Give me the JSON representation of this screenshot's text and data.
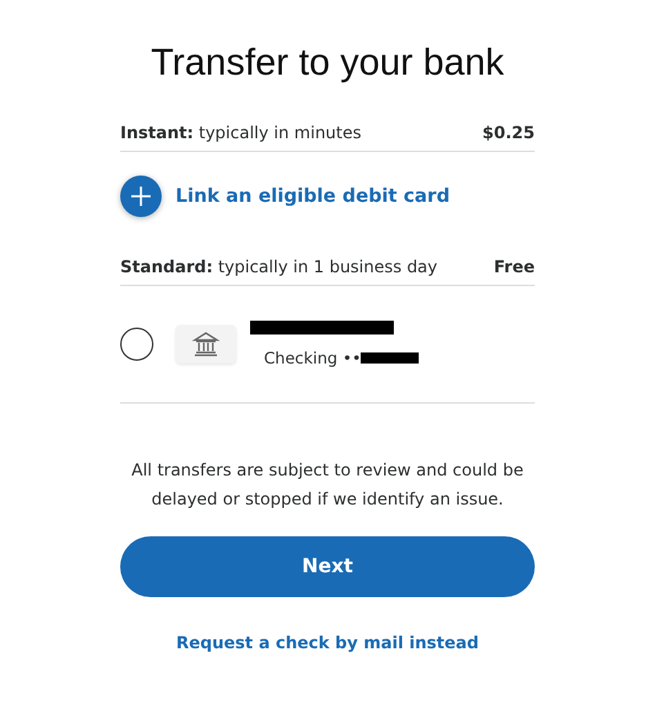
{
  "title": "Transfer to your bank",
  "instant": {
    "label": "**Instant:** typically in minutes",
    "fee": "$0.25",
    "link": "Link an eligible debit card"
  },
  "standard": {
    "label": "**Standard:** typically in 1 business day",
    "fee": "Free"
  },
  "accounts": [
    {
      "selected": false,
      "name_redacted": true,
      "type": "Checking ••",
      "number_redacted": true
    }
  ],
  "notice": "All transfers are subject to review and could be delayed or stopped if we identify an issue.",
  "next_button": "Next",
  "alt_link": "Request a check by mail instead"
}
